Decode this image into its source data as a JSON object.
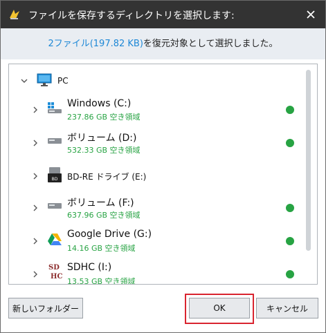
{
  "window": {
    "title": "ファイルを保存するディレクトリを選択します:"
  },
  "info": {
    "count_link": "2ファイル(197.82 KB)",
    "suffix": "を復元対象として選択しました。"
  },
  "tree": {
    "root": {
      "label": "PC"
    },
    "drives": [
      {
        "label": "Windows (C:)",
        "space": "237.86 GB 空き領域",
        "icon": "windows-drive-icon"
      },
      {
        "label": "ボリューム (D:)",
        "space": "532.33 GB 空き領域",
        "icon": "hard-drive-icon"
      },
      {
        "label": "BD-RE ドライブ (E:)",
        "space": "",
        "icon": "bd-drive-icon"
      },
      {
        "label": "ボリューム (F:)",
        "space": "637.96 GB 空き領域",
        "icon": "hard-drive-icon"
      },
      {
        "label": "Google Drive (G:)",
        "space": "14.16 GB 空き領域",
        "icon": "google-drive-icon"
      },
      {
        "label": "SDHC (I:)",
        "space": "13.53 GB 空き領域",
        "icon": "sdhc-card-icon"
      }
    ]
  },
  "buttons": {
    "new_folder": "新しいフォルダー",
    "ok": "OK",
    "cancel": "キャンセル"
  },
  "colors": {
    "titlebar": "#333333",
    "accent_link": "#1e88d6",
    "status_green": "#27a343",
    "highlight_red": "#d9242f"
  }
}
